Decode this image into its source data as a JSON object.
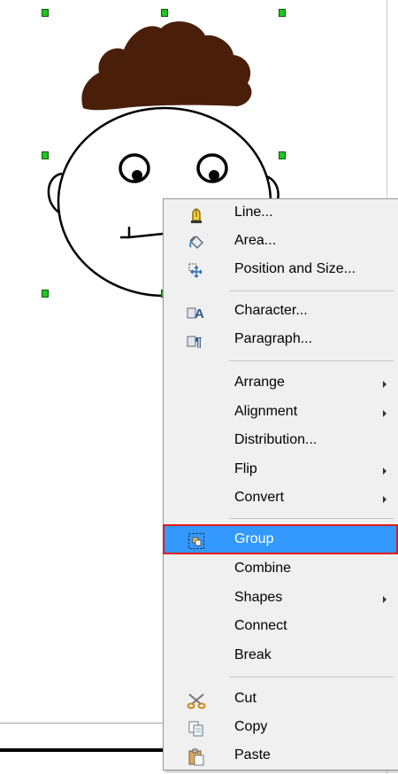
{
  "menu": {
    "items": [
      {
        "label": "Line...",
        "icon": "line-pen-icon",
        "submenu": false
      },
      {
        "label": "Area...",
        "icon": "paint-bucket-icon",
        "submenu": false
      },
      {
        "label": "Position and Size...",
        "icon": "position-size-icon",
        "submenu": false
      },
      {
        "label": "Character...",
        "icon": "character-icon",
        "submenu": false
      },
      {
        "label": "Paragraph...",
        "icon": "paragraph-icon",
        "submenu": false
      },
      {
        "label": "Arrange",
        "icon": "",
        "submenu": true
      },
      {
        "label": "Alignment",
        "icon": "",
        "submenu": true
      },
      {
        "label": "Distribution...",
        "icon": "",
        "submenu": false
      },
      {
        "label": "Flip",
        "icon": "",
        "submenu": true
      },
      {
        "label": "Convert",
        "icon": "",
        "submenu": true
      },
      {
        "label": "Group",
        "icon": "group-icon",
        "submenu": false,
        "highlighted": true
      },
      {
        "label": "Combine",
        "icon": "",
        "submenu": false
      },
      {
        "label": "Shapes",
        "icon": "",
        "submenu": true
      },
      {
        "label": "Connect",
        "icon": "",
        "submenu": false
      },
      {
        "label": "Break",
        "icon": "",
        "submenu": false
      },
      {
        "label": "Cut",
        "icon": "scissors-icon",
        "submenu": false
      },
      {
        "label": "Copy",
        "icon": "copy-icon",
        "submenu": false
      },
      {
        "label": "Paste",
        "icon": "paste-icon",
        "submenu": false
      }
    ]
  },
  "colors": {
    "hair": "#4a1f0a",
    "handle": "#21c521",
    "highlight": "#3399ff",
    "highlight_frame": "#e31a1a"
  }
}
